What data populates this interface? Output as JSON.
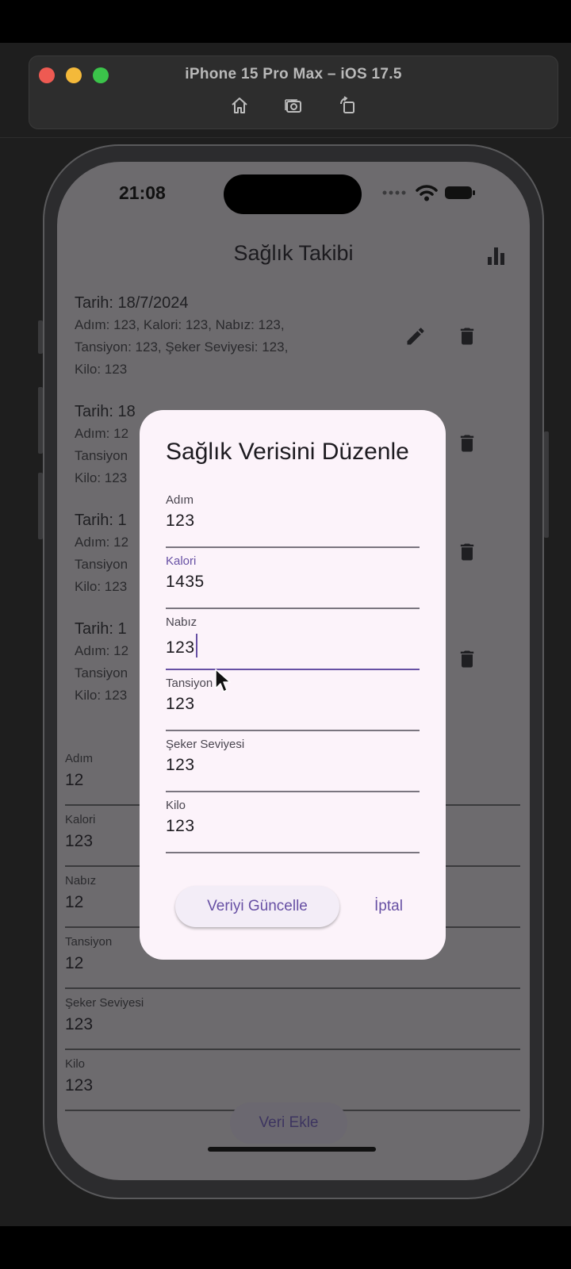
{
  "simulator": {
    "title": "iPhone 15 Pro Max – iOS 17.5",
    "tools": [
      "home-icon",
      "screenshot-icon",
      "rotate-icon"
    ]
  },
  "status_bar": {
    "time": "21:08"
  },
  "app": {
    "title": "Sağlık Takibi",
    "chart_icon": "bar-chart-icon",
    "entries": [
      {
        "title": "Tarih: 18/7/2024",
        "lines": [
          "Adım: 123, Kalori: 123, Nabız: 123,",
          "Tansiyon: 123, Şeker Seviyesi: 123,",
          "Kilo: 123"
        ]
      },
      {
        "title": "Tarih: 18",
        "lines": [
          "Adım: 12",
          "Tansiyon",
          "Kilo: 123"
        ]
      },
      {
        "title": "Tarih: 1",
        "lines": [
          "Adım: 12",
          "Tansiyon",
          "Kilo: 123"
        ]
      },
      {
        "title": "Tarih: 1",
        "lines": [
          "Adım: 12",
          "Tansiyon",
          "Kilo: 123"
        ]
      }
    ],
    "form": [
      {
        "label": "Adım",
        "value": "12"
      },
      {
        "label": "Kalori",
        "value": "123"
      },
      {
        "label": "Nabız",
        "value": "12"
      },
      {
        "label": "Tansiyon",
        "value": "12"
      },
      {
        "label": "Şeker Seviyesi",
        "value": "123"
      },
      {
        "label": "Kilo",
        "value": "123"
      }
    ],
    "add_button": "Veri Ekle"
  },
  "dialog": {
    "title": "Sağlık Verisini Düzenle",
    "fields": [
      {
        "label": "Adım",
        "value": "123"
      },
      {
        "label": "Kalori",
        "value": "1435"
      },
      {
        "label": "Nabız",
        "value": "123"
      },
      {
        "label": "Tansiyon",
        "value": "123"
      },
      {
        "label": "Şeker Seviyesi",
        "value": "123"
      },
      {
        "label": "Kilo",
        "value": "123"
      }
    ],
    "update_button": "Veriyi Güncelle",
    "cancel_button": "İptal"
  },
  "colors": {
    "accent": "#6750a4",
    "dialog_bg": "#fcf3fa",
    "scrim_screen": "#6d6b6e"
  }
}
